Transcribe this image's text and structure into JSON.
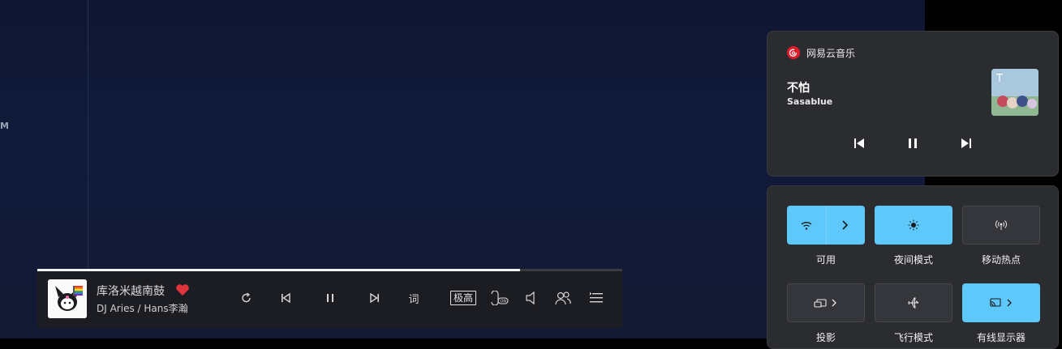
{
  "desktop": {
    "side_letter": "M"
  },
  "player": {
    "progress": 0.825,
    "song_title": "库洛米越南鼓",
    "artist": "DJ Aries / Hans李瀚",
    "lyric_label": "词",
    "quality_label": "极高",
    "liked": true,
    "accent_color": "#e0343b"
  },
  "media_flyout": {
    "app_name": "网易云音乐",
    "title": "不怕",
    "artist": "Sasablue",
    "brand_color": "#e11b2a"
  },
  "quick_settings": {
    "accent_color": "#5fc8fb",
    "tiles": [
      {
        "label": "可用",
        "icon": "wifi-icon",
        "state": "on"
      },
      {
        "label": "夜间模式",
        "icon": "night-light-icon",
        "state": "on"
      },
      {
        "label": "移动热点",
        "icon": "hotspot-icon",
        "state": "off"
      },
      {
        "label": "投影",
        "icon": "project-icon",
        "state": "off"
      },
      {
        "label": "飞行模式",
        "icon": "airplane-icon",
        "state": "off"
      },
      {
        "label": "有线显示器",
        "icon": "cast-icon",
        "state": "on"
      }
    ]
  }
}
